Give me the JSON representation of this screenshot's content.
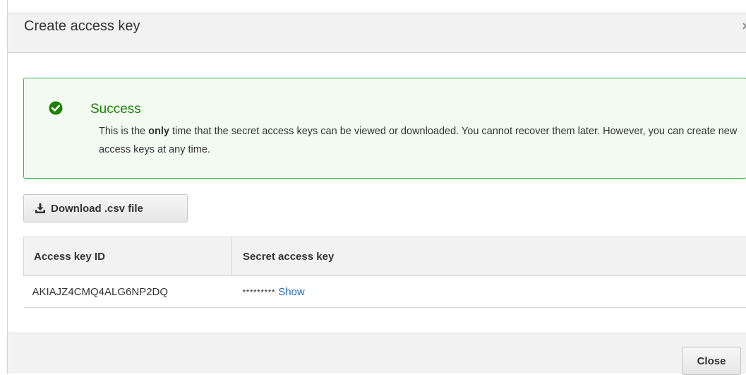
{
  "dialog": {
    "title": "Create access key",
    "close_symbol": "×"
  },
  "alert": {
    "icon": "check-circle-icon",
    "title": "Success",
    "body_before": "This is the ",
    "body_bold": "only",
    "body_after": " time that the secret access keys can be viewed or downloaded. You cannot recover them later. However, you can create new access keys at any time.",
    "border_color": "#2fb548",
    "title_color": "#1d8102"
  },
  "download": {
    "icon": "download-icon",
    "label": "Download .csv file"
  },
  "table": {
    "headers": [
      "Access key ID",
      "Secret access key"
    ],
    "rows": [
      {
        "access_key_id": "AKIAJZ4CMQ4ALG6NP2DQ",
        "secret_masked": "*********",
        "show_label": "Show"
      }
    ]
  },
  "footer": {
    "close_label": "Close"
  },
  "colors": {
    "link": "#1f67c2",
    "header_bg": "#f2f2f2"
  }
}
